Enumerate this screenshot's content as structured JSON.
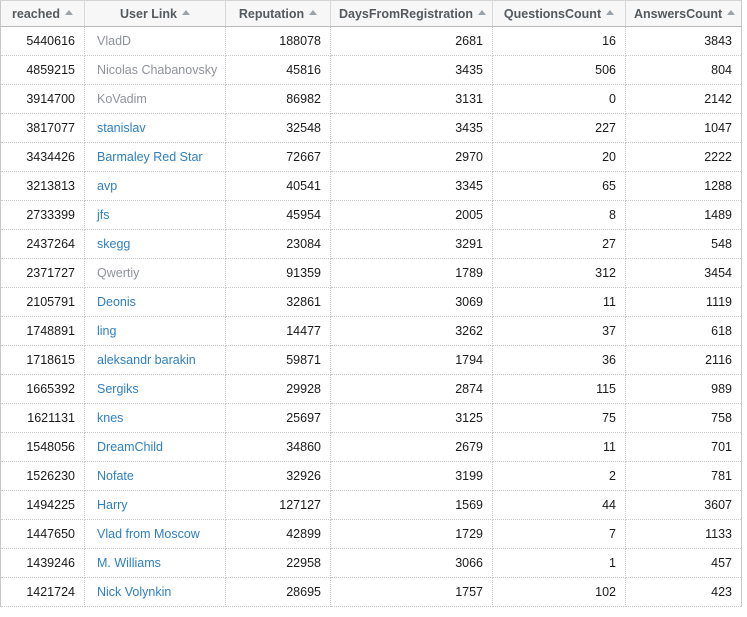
{
  "table": {
    "sort_icon": "sort-asc-triangle",
    "columns": [
      {
        "key": "reached",
        "label": "reached",
        "align": "right",
        "sorted": true
      },
      {
        "key": "user",
        "label": "User Link",
        "align": "left",
        "sorted": true
      },
      {
        "key": "rep",
        "label": "Reputation",
        "align": "right",
        "sorted": true
      },
      {
        "key": "days",
        "label": "DaysFromRegistration",
        "align": "right",
        "sorted": true
      },
      {
        "key": "qcount",
        "label": "QuestionsCount",
        "align": "right",
        "sorted": true
      },
      {
        "key": "acount",
        "label": "AnswersCount",
        "align": "right",
        "sorted": true
      }
    ],
    "rows": [
      {
        "reached": "5440616",
        "user": "VladD",
        "visited": true,
        "rep": "188078",
        "days": "2681",
        "qcount": "16",
        "acount": "3843"
      },
      {
        "reached": "4859215",
        "user": "Nicolas Chabanovsky",
        "visited": true,
        "rep": "45816",
        "days": "3435",
        "qcount": "506",
        "acount": "804"
      },
      {
        "reached": "3914700",
        "user": "KoVadim",
        "visited": true,
        "rep": "86982",
        "days": "3131",
        "qcount": "0",
        "acount": "2142"
      },
      {
        "reached": "3817077",
        "user": "stanislav",
        "visited": false,
        "rep": "32548",
        "days": "3435",
        "qcount": "227",
        "acount": "1047"
      },
      {
        "reached": "3434426",
        "user": "Barmaley Red Star",
        "visited": false,
        "rep": "72667",
        "days": "2970",
        "qcount": "20",
        "acount": "2222"
      },
      {
        "reached": "3213813",
        "user": "avp",
        "visited": false,
        "rep": "40541",
        "days": "3345",
        "qcount": "65",
        "acount": "1288"
      },
      {
        "reached": "2733399",
        "user": "jfs",
        "visited": false,
        "rep": "45954",
        "days": "2005",
        "qcount": "8",
        "acount": "1489"
      },
      {
        "reached": "2437264",
        "user": "skegg",
        "visited": false,
        "rep": "23084",
        "days": "3291",
        "qcount": "27",
        "acount": "548"
      },
      {
        "reached": "2371727",
        "user": "Qwertiy",
        "visited": true,
        "rep": "91359",
        "days": "1789",
        "qcount": "312",
        "acount": "3454"
      },
      {
        "reached": "2105791",
        "user": "Deonis",
        "visited": false,
        "rep": "32861",
        "days": "3069",
        "qcount": "11",
        "acount": "1119"
      },
      {
        "reached": "1748891",
        "user": "ling",
        "visited": false,
        "rep": "14477",
        "days": "3262",
        "qcount": "37",
        "acount": "618"
      },
      {
        "reached": "1718615",
        "user": "aleksandr barakin",
        "visited": false,
        "rep": "59871",
        "days": "1794",
        "qcount": "36",
        "acount": "2116"
      },
      {
        "reached": "1665392",
        "user": "Sergiks",
        "visited": false,
        "rep": "29928",
        "days": "2874",
        "qcount": "115",
        "acount": "989"
      },
      {
        "reached": "1621131",
        "user": "knes",
        "visited": false,
        "rep": "25697",
        "days": "3125",
        "qcount": "75",
        "acount": "758"
      },
      {
        "reached": "1548056",
        "user": "DreamChild",
        "visited": false,
        "rep": "34860",
        "days": "2679",
        "qcount": "11",
        "acount": "701"
      },
      {
        "reached": "1526230",
        "user": "Nofate",
        "visited": false,
        "rep": "32926",
        "days": "3199",
        "qcount": "2",
        "acount": "781"
      },
      {
        "reached": "1494225",
        "user": "Harry",
        "visited": false,
        "rep": "127127",
        "days": "1569",
        "qcount": "44",
        "acount": "3607"
      },
      {
        "reached": "1447650",
        "user": "Vlad from Moscow",
        "visited": false,
        "rep": "42899",
        "days": "1729",
        "qcount": "7",
        "acount": "1133"
      },
      {
        "reached": "1439246",
        "user": "M. Williams",
        "visited": false,
        "rep": "22958",
        "days": "3066",
        "qcount": "1",
        "acount": "457"
      },
      {
        "reached": "1421724",
        "user": "Nick Volynkin",
        "visited": false,
        "rep": "28695",
        "days": "1757",
        "qcount": "102",
        "acount": "423"
      }
    ]
  },
  "colors": {
    "link": "#2f7fc1",
    "link_visited": "#8f9399",
    "header_bg": "#f7f7f7",
    "header_text": "#555a5f",
    "grid_line": "#c9c9c9"
  }
}
